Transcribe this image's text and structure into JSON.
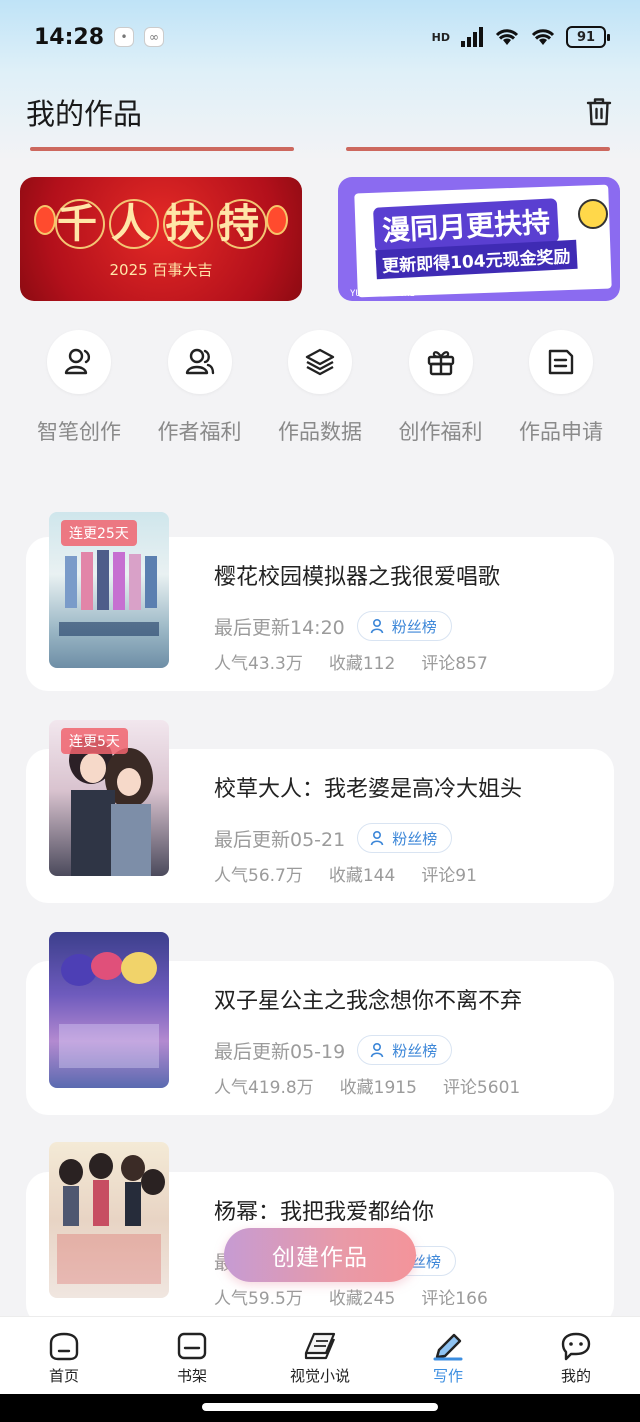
{
  "status_bar": {
    "time": "14:28",
    "network": "HD",
    "battery": "91"
  },
  "header": {
    "title": "我的作品"
  },
  "banners": [
    {
      "title": "千人扶持",
      "title_chars": [
        "千",
        "人",
        "扶",
        "持"
      ],
      "subtitle": "2025  百事大吉"
    },
    {
      "title": "漫同月更扶持",
      "subtitle": "更新即得104元现金奖励",
      "footer": "YUEGENGFUCHI"
    }
  ],
  "shortcuts": [
    {
      "label": "智笔创作",
      "icon": "user-pen-icon"
    },
    {
      "label": "作者福利",
      "icon": "users-icon"
    },
    {
      "label": "作品数据",
      "icon": "layers-icon"
    },
    {
      "label": "创作福利",
      "icon": "gift-icon"
    },
    {
      "label": "作品申请",
      "icon": "document-icon"
    }
  ],
  "works": [
    {
      "title": "樱花校园模拟器之我很爱唱歌",
      "badge": "连更25天",
      "update": "最后更新14:20",
      "fans_label": "粉丝榜",
      "popularity": "人气43.3万",
      "favorites": "收藏112",
      "comments": "评论857"
    },
    {
      "title": "校草大人：我老婆是高冷大姐头",
      "badge": "连更5天",
      "update": "最后更新05-21",
      "fans_label": "粉丝榜",
      "popularity": "人气56.7万",
      "favorites": "收藏144",
      "comments": "评论91"
    },
    {
      "title": "双子星公主之我念想你不离不弃",
      "badge": "",
      "update": "最后更新05-19",
      "fans_label": "粉丝榜",
      "popularity": "人气419.8万",
      "favorites": "收藏1915",
      "comments": "评论5601"
    },
    {
      "title": "杨幂：我把我爱都给你",
      "badge": "",
      "update": "最",
      "fans_label": "粉丝榜",
      "popularity": "人气59.5万",
      "favorites": "收藏245",
      "comments": "评论166"
    }
  ],
  "create_button": "创建作品",
  "tabbar": [
    {
      "label": "首页",
      "icon": "home-icon",
      "active": false
    },
    {
      "label": "书架",
      "icon": "bookshelf-icon",
      "active": false
    },
    {
      "label": "视觉小说",
      "icon": "book-icon",
      "active": false
    },
    {
      "label": "写作",
      "icon": "pen-icon",
      "active": true
    },
    {
      "label": "我的",
      "icon": "chat-bubble-icon",
      "active": false
    }
  ],
  "colors": {
    "accent": "#3c8ee0",
    "badge": "#f0646e",
    "create_button": "#e89aa8"
  }
}
